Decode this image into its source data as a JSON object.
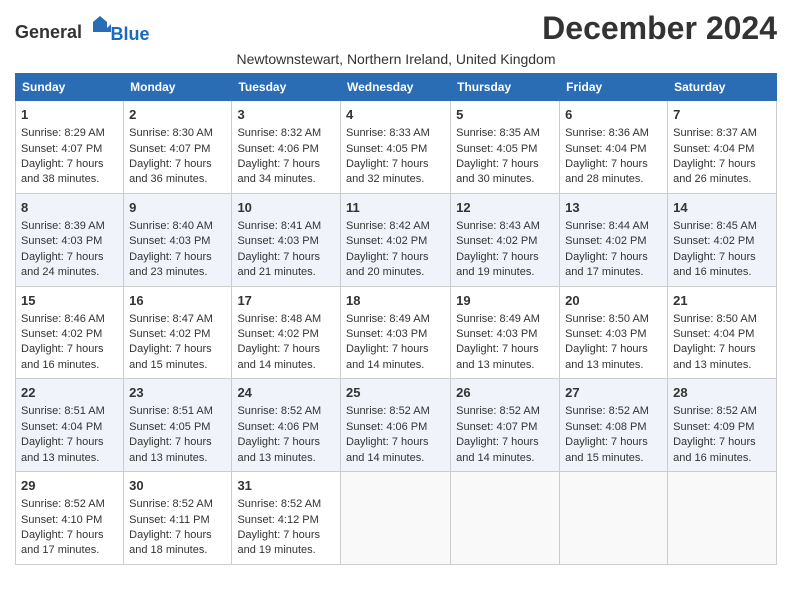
{
  "header": {
    "logo_general": "General",
    "logo_blue": "Blue",
    "month_title": "December 2024",
    "location": "Newtownstewart, Northern Ireland, United Kingdom"
  },
  "days_of_week": [
    "Sunday",
    "Monday",
    "Tuesday",
    "Wednesday",
    "Thursday",
    "Friday",
    "Saturday"
  ],
  "weeks": [
    [
      {
        "day": "1",
        "sunrise": "Sunrise: 8:29 AM",
        "sunset": "Sunset: 4:07 PM",
        "daylight": "Daylight: 7 hours and 38 minutes."
      },
      {
        "day": "2",
        "sunrise": "Sunrise: 8:30 AM",
        "sunset": "Sunset: 4:07 PM",
        "daylight": "Daylight: 7 hours and 36 minutes."
      },
      {
        "day": "3",
        "sunrise": "Sunrise: 8:32 AM",
        "sunset": "Sunset: 4:06 PM",
        "daylight": "Daylight: 7 hours and 34 minutes."
      },
      {
        "day": "4",
        "sunrise": "Sunrise: 8:33 AM",
        "sunset": "Sunset: 4:05 PM",
        "daylight": "Daylight: 7 hours and 32 minutes."
      },
      {
        "day": "5",
        "sunrise": "Sunrise: 8:35 AM",
        "sunset": "Sunset: 4:05 PM",
        "daylight": "Daylight: 7 hours and 30 minutes."
      },
      {
        "day": "6",
        "sunrise": "Sunrise: 8:36 AM",
        "sunset": "Sunset: 4:04 PM",
        "daylight": "Daylight: 7 hours and 28 minutes."
      },
      {
        "day": "7",
        "sunrise": "Sunrise: 8:37 AM",
        "sunset": "Sunset: 4:04 PM",
        "daylight": "Daylight: 7 hours and 26 minutes."
      }
    ],
    [
      {
        "day": "8",
        "sunrise": "Sunrise: 8:39 AM",
        "sunset": "Sunset: 4:03 PM",
        "daylight": "Daylight: 7 hours and 24 minutes."
      },
      {
        "day": "9",
        "sunrise": "Sunrise: 8:40 AM",
        "sunset": "Sunset: 4:03 PM",
        "daylight": "Daylight: 7 hours and 23 minutes."
      },
      {
        "day": "10",
        "sunrise": "Sunrise: 8:41 AM",
        "sunset": "Sunset: 4:03 PM",
        "daylight": "Daylight: 7 hours and 21 minutes."
      },
      {
        "day": "11",
        "sunrise": "Sunrise: 8:42 AM",
        "sunset": "Sunset: 4:02 PM",
        "daylight": "Daylight: 7 hours and 20 minutes."
      },
      {
        "day": "12",
        "sunrise": "Sunrise: 8:43 AM",
        "sunset": "Sunset: 4:02 PM",
        "daylight": "Daylight: 7 hours and 19 minutes."
      },
      {
        "day": "13",
        "sunrise": "Sunrise: 8:44 AM",
        "sunset": "Sunset: 4:02 PM",
        "daylight": "Daylight: 7 hours and 17 minutes."
      },
      {
        "day": "14",
        "sunrise": "Sunrise: 8:45 AM",
        "sunset": "Sunset: 4:02 PM",
        "daylight": "Daylight: 7 hours and 16 minutes."
      }
    ],
    [
      {
        "day": "15",
        "sunrise": "Sunrise: 8:46 AM",
        "sunset": "Sunset: 4:02 PM",
        "daylight": "Daylight: 7 hours and 16 minutes."
      },
      {
        "day": "16",
        "sunrise": "Sunrise: 8:47 AM",
        "sunset": "Sunset: 4:02 PM",
        "daylight": "Daylight: 7 hours and 15 minutes."
      },
      {
        "day": "17",
        "sunrise": "Sunrise: 8:48 AM",
        "sunset": "Sunset: 4:02 PM",
        "daylight": "Daylight: 7 hours and 14 minutes."
      },
      {
        "day": "18",
        "sunrise": "Sunrise: 8:49 AM",
        "sunset": "Sunset: 4:03 PM",
        "daylight": "Daylight: 7 hours and 14 minutes."
      },
      {
        "day": "19",
        "sunrise": "Sunrise: 8:49 AM",
        "sunset": "Sunset: 4:03 PM",
        "daylight": "Daylight: 7 hours and 13 minutes."
      },
      {
        "day": "20",
        "sunrise": "Sunrise: 8:50 AM",
        "sunset": "Sunset: 4:03 PM",
        "daylight": "Daylight: 7 hours and 13 minutes."
      },
      {
        "day": "21",
        "sunrise": "Sunrise: 8:50 AM",
        "sunset": "Sunset: 4:04 PM",
        "daylight": "Daylight: 7 hours and 13 minutes."
      }
    ],
    [
      {
        "day": "22",
        "sunrise": "Sunrise: 8:51 AM",
        "sunset": "Sunset: 4:04 PM",
        "daylight": "Daylight: 7 hours and 13 minutes."
      },
      {
        "day": "23",
        "sunrise": "Sunrise: 8:51 AM",
        "sunset": "Sunset: 4:05 PM",
        "daylight": "Daylight: 7 hours and 13 minutes."
      },
      {
        "day": "24",
        "sunrise": "Sunrise: 8:52 AM",
        "sunset": "Sunset: 4:06 PM",
        "daylight": "Daylight: 7 hours and 13 minutes."
      },
      {
        "day": "25",
        "sunrise": "Sunrise: 8:52 AM",
        "sunset": "Sunset: 4:06 PM",
        "daylight": "Daylight: 7 hours and 14 minutes."
      },
      {
        "day": "26",
        "sunrise": "Sunrise: 8:52 AM",
        "sunset": "Sunset: 4:07 PM",
        "daylight": "Daylight: 7 hours and 14 minutes."
      },
      {
        "day": "27",
        "sunrise": "Sunrise: 8:52 AM",
        "sunset": "Sunset: 4:08 PM",
        "daylight": "Daylight: 7 hours and 15 minutes."
      },
      {
        "day": "28",
        "sunrise": "Sunrise: 8:52 AM",
        "sunset": "Sunset: 4:09 PM",
        "daylight": "Daylight: 7 hours and 16 minutes."
      }
    ],
    [
      {
        "day": "29",
        "sunrise": "Sunrise: 8:52 AM",
        "sunset": "Sunset: 4:10 PM",
        "daylight": "Daylight: 7 hours and 17 minutes."
      },
      {
        "day": "30",
        "sunrise": "Sunrise: 8:52 AM",
        "sunset": "Sunset: 4:11 PM",
        "daylight": "Daylight: 7 hours and 18 minutes."
      },
      {
        "day": "31",
        "sunrise": "Sunrise: 8:52 AM",
        "sunset": "Sunset: 4:12 PM",
        "daylight": "Daylight: 7 hours and 19 minutes."
      },
      null,
      null,
      null,
      null
    ]
  ]
}
